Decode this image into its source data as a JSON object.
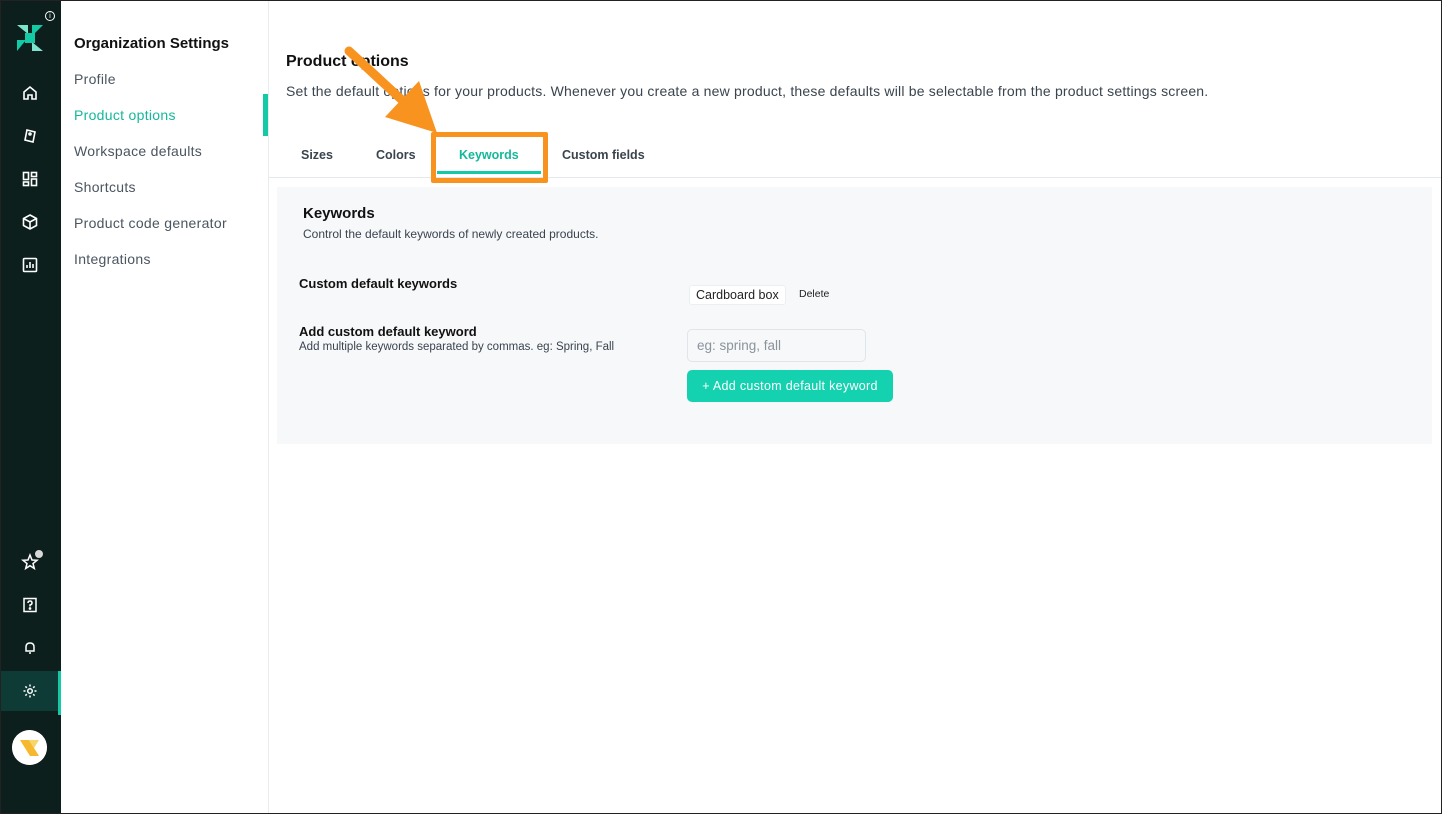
{
  "sidebar": {
    "title": "Organization Settings",
    "items": [
      {
        "label": "Profile"
      },
      {
        "label": "Product options"
      },
      {
        "label": "Workspace defaults"
      },
      {
        "label": "Shortcuts"
      },
      {
        "label": "Product code generator"
      },
      {
        "label": "Integrations"
      }
    ],
    "active_item": "Product options"
  },
  "rail": {
    "top_icons": [
      "home-icon",
      "tag-icon",
      "dashboard-icon",
      "box-icon",
      "chart-icon"
    ],
    "bottom_icons": [
      "star-icon",
      "help-icon",
      "bell-icon",
      "gear-icon"
    ],
    "active_icon": "gear-icon",
    "info_glyph": "i"
  },
  "header": {
    "title": "Product options",
    "description": "Set the default options for your products. Whenever you create a new product, these defaults will be selectable from the product settings screen."
  },
  "tabs": [
    {
      "label": "Sizes"
    },
    {
      "label": "Colors"
    },
    {
      "label": "Keywords"
    },
    {
      "label": "Custom fields"
    }
  ],
  "active_tab": "Keywords",
  "keywords_section": {
    "title": "Keywords",
    "subtitle": "Control the default keywords of newly created products.",
    "custom_label": "Custom default keywords",
    "keywords": [
      {
        "text": "Cardboard box",
        "delete_label": "Delete"
      }
    ],
    "add_label": "Add custom default keyword",
    "add_help": "Add multiple keywords separated by commas. eg: Spring, Fall",
    "input_placeholder": "eg: spring, fall",
    "input_value": "",
    "add_button_label": "+ Add custom default keyword"
  },
  "colors": {
    "accent": "#14c9a6",
    "rail_bg": "#0c1f1d",
    "highlight": "#f7931e",
    "card_bg": "#f7f8fa"
  }
}
